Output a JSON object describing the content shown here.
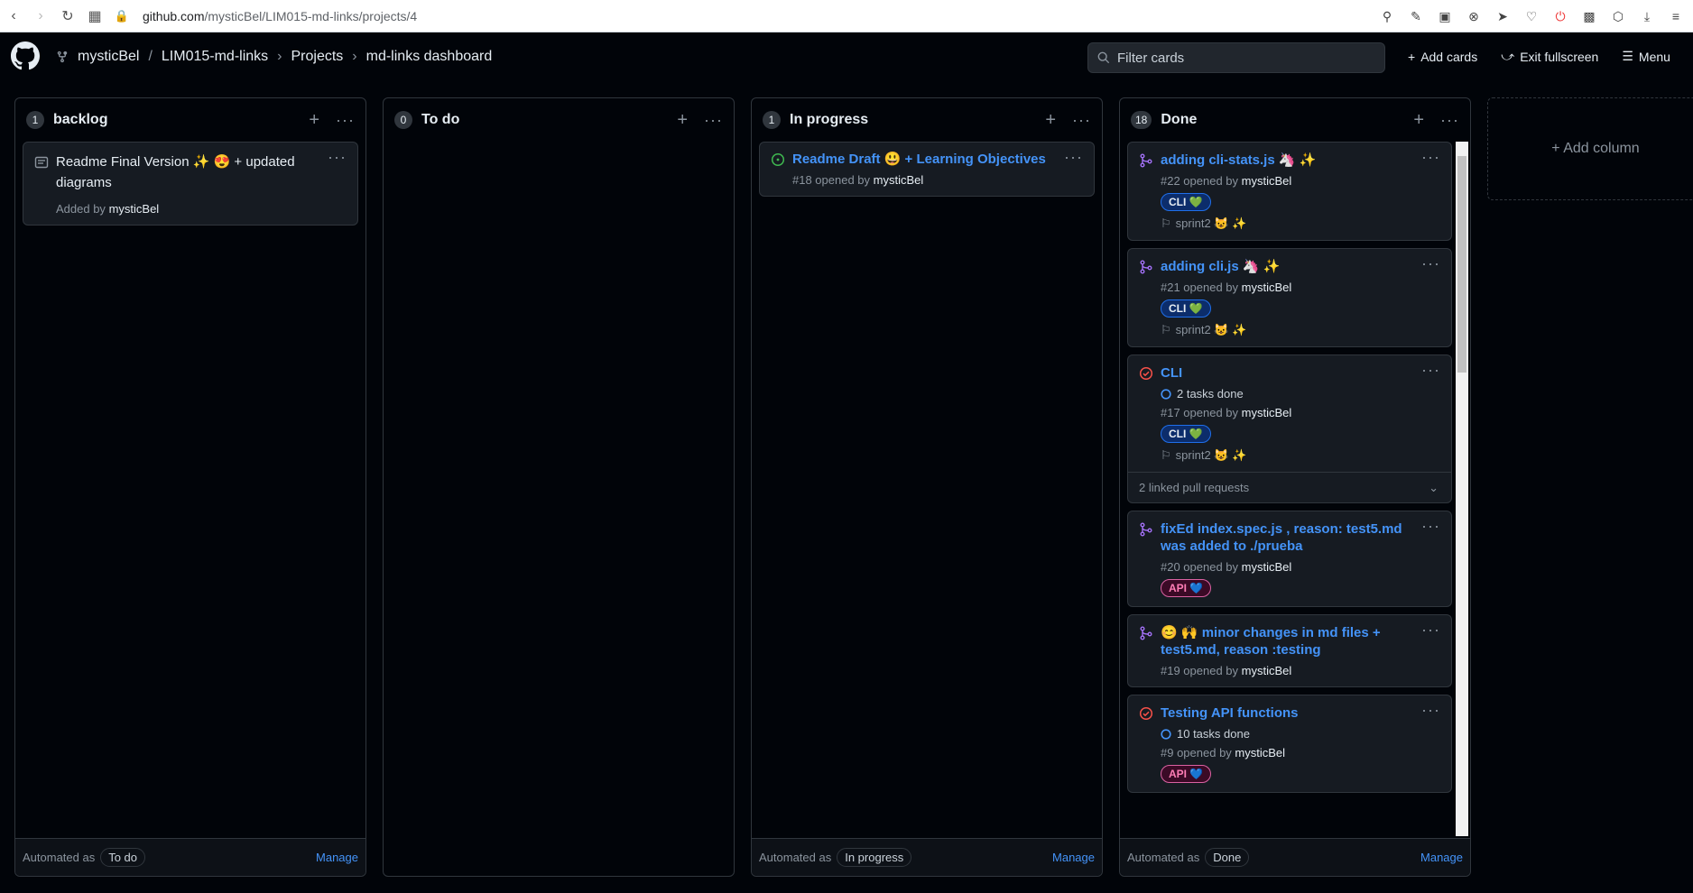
{
  "browser": {
    "url_host": "github.com",
    "url_path": "/mysticBel/LIM015-md-links/projects/4"
  },
  "header": {
    "owner": "mysticBel",
    "repo": "LIM015-md-links",
    "projects": "Projects",
    "board": "md-links dashboard",
    "filter_placeholder": "Filter cards",
    "add_cards": "Add cards",
    "exit_fullscreen": "Exit fullscreen",
    "menu": "Menu",
    "slash": "/",
    "sep": "›"
  },
  "columns": [
    {
      "title": "backlog",
      "count": "1",
      "automated": "Automated as",
      "auto_state": "To do",
      "manage": "Manage",
      "cards": [
        {
          "note": "Readme Final Version ✨ 😍 + updated diagrams",
          "added": "Added by",
          "author": "mysticBel"
        }
      ]
    },
    {
      "title": "To do",
      "count": "0"
    },
    {
      "title": "In progress",
      "count": "1",
      "automated": "Automated as",
      "auto_state": "In progress",
      "manage": "Manage",
      "cards": [
        {
          "title": "Readme Draft 😃 + Learning Objectives",
          "meta": "#18 opened by",
          "author": "mysticBel"
        }
      ]
    },
    {
      "title": "Done",
      "count": "18",
      "automated": "Automated as",
      "auto_state": "Done",
      "manage": "Manage",
      "cards": [
        {
          "title": "adding cli-stats.js 🦄 ✨",
          "meta": "#22 opened by",
          "author": "mysticBel",
          "label": "CLI 💚",
          "milestone": "sprint2 😺 ✨"
        },
        {
          "title": "adding cli.js 🦄 ✨",
          "meta": "#21 opened by",
          "author": "mysticBel",
          "label": "CLI 💚",
          "milestone": "sprint2 😺 ✨"
        },
        {
          "title": "CLI",
          "tasks": "2 tasks done",
          "meta": "#17 opened by",
          "author": "mysticBel",
          "label": "CLI 💚",
          "milestone": "sprint2 😺 ✨",
          "linked": "2 linked pull requests"
        },
        {
          "title": "fixEd index.spec.js , reason: test5.md was added to ./prueba",
          "meta": "#20 opened by",
          "author": "mysticBel",
          "label": "API 💙"
        },
        {
          "title": "😊 🙌 minor changes in md files + test5.md, reason :testing",
          "meta": "#19 opened by",
          "author": "mysticBel"
        },
        {
          "title": "Testing API functions",
          "tasks": "10 tasks done",
          "meta": "#9 opened by",
          "author": "mysticBel",
          "label": "API 💙"
        }
      ]
    }
  ],
  "add_column": "+ Add column",
  "colors": {
    "link": "#4493f8",
    "open_green": "#3fb950",
    "closed_red": "#f85149",
    "pr_purple": "#a371f7"
  }
}
